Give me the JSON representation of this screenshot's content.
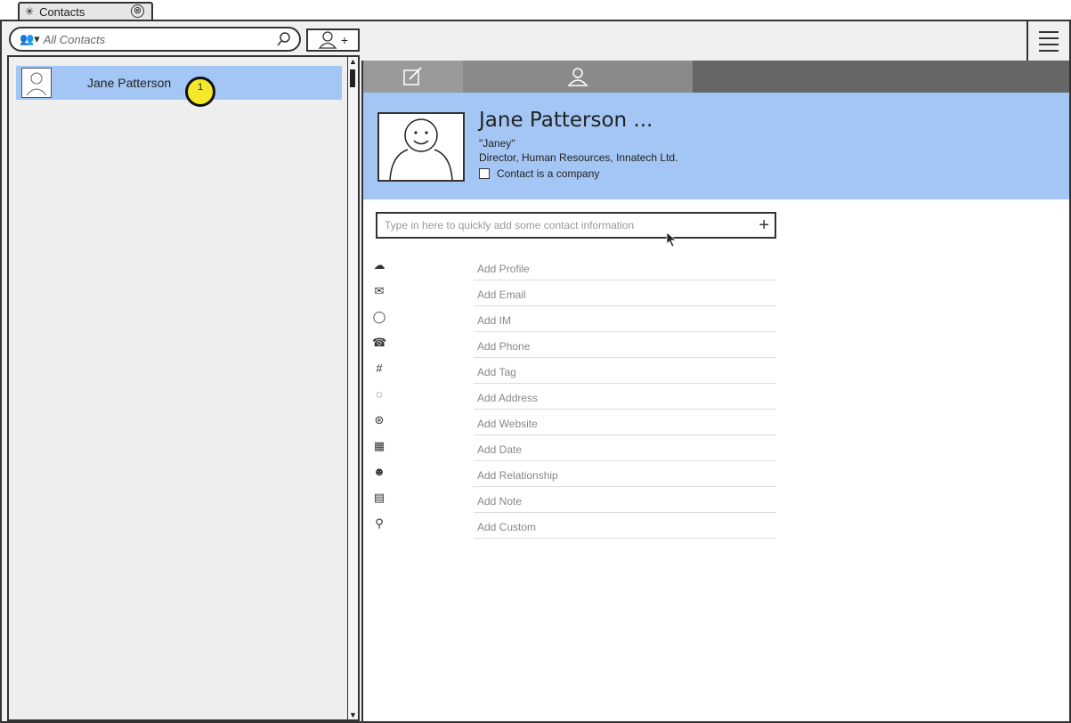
{
  "tab": {
    "title": "Contacts",
    "close": "⊗"
  },
  "search": {
    "placeholder": "All Contacts"
  },
  "toolbar": {
    "add_contact_plus": "+"
  },
  "list": {
    "contacts": [
      {
        "name": "Jane Patterson"
      }
    ],
    "badge": "1"
  },
  "detail": {
    "name": "Jane Patterson ...",
    "nickname": "\"Janey\"",
    "job": "Director, Human Resources, Innatech Ltd.",
    "company_checkbox": "Contact is a company",
    "quick_add": {
      "placeholder": "Type in here to quickly add some contact information",
      "plus": "+"
    },
    "fields": [
      {
        "icon": "cloud-icon",
        "glyph": "☁",
        "label": "Add Profile"
      },
      {
        "icon": "email-icon",
        "glyph": "✉",
        "label": "Add Email"
      },
      {
        "icon": "chat-icon",
        "glyph": "◯",
        "label": "Add IM"
      },
      {
        "icon": "phone-icon",
        "glyph": "☎",
        "label": "Add Phone"
      },
      {
        "icon": "hash-icon",
        "glyph": "#",
        "label": "Add Tag"
      },
      {
        "icon": "location-icon",
        "glyph": "◌",
        "label": "Add Address"
      },
      {
        "icon": "globe-icon",
        "glyph": "⊛",
        "label": "Add Website"
      },
      {
        "icon": "calendar-icon",
        "glyph": "▦",
        "label": "Add Date"
      },
      {
        "icon": "people-icon",
        "glyph": "☻",
        "label": "Add Relationship"
      },
      {
        "icon": "note-icon",
        "glyph": "▤",
        "label": "Add Note"
      },
      {
        "icon": "pin-icon",
        "glyph": "⚲",
        "label": "Add Custom"
      }
    ]
  },
  "colors": {
    "selection": "#a4c6f4",
    "badge": "#f4e82a",
    "tabbar": "#666666"
  }
}
